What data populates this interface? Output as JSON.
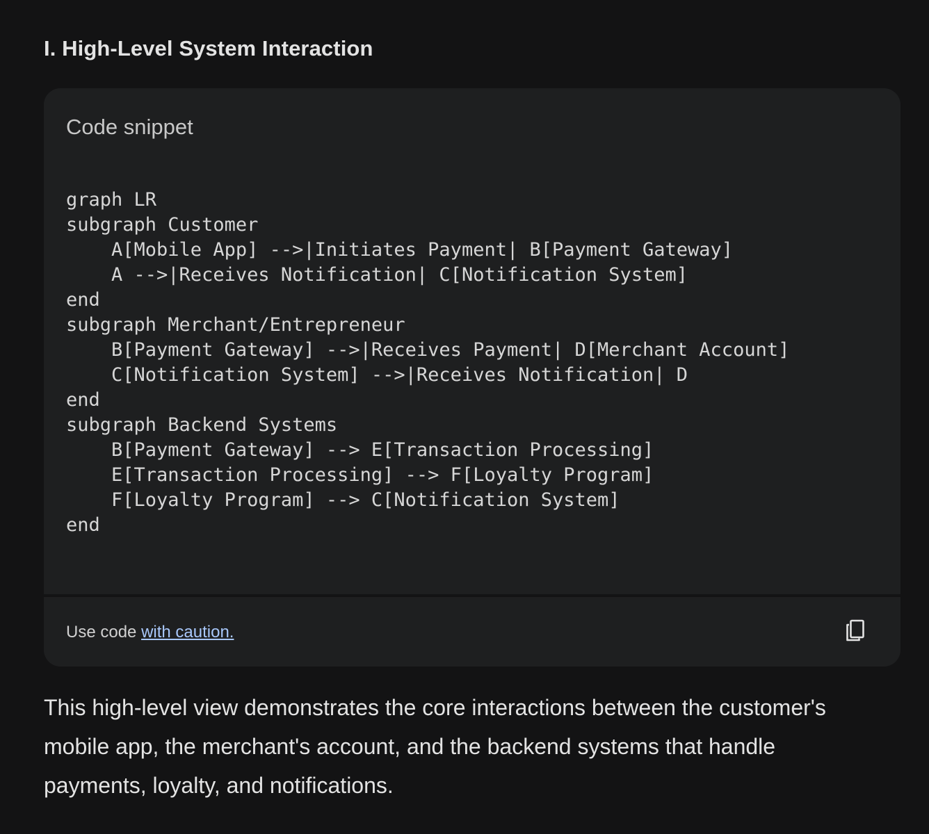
{
  "heading": "I. High-Level System Interaction",
  "code_card": {
    "title": "Code snippet",
    "lines": [
      "graph LR",
      "subgraph Customer",
      "    A[Mobile App] -->|Initiates Payment| B[Payment Gateway]",
      "    A -->|Receives Notification| C[Notification System]",
      "end",
      "subgraph Merchant/Entrepreneur",
      "    B[Payment Gateway] -->|Receives Payment| D[Merchant Account]",
      "    C[Notification System] -->|Receives Notification| D",
      "end",
      "subgraph Backend Systems",
      "    B[Payment Gateway] --> E[Transaction Processing]",
      "    E[Transaction Processing] --> F[Loyalty Program]",
      "    F[Loyalty Program] --> C[Notification System]",
      "end"
    ],
    "footer": {
      "prefix": "Use code ",
      "link_text": "with caution.",
      "copy_icon": "copy-icon"
    }
  },
  "paragraph": "This high-level view demonstrates the core interactions between the customer's mobile app, the merchant's account, and the backend systems that handle payments, loyalty, and notifications.",
  "colors": {
    "background": "#131314",
    "card": "#1e1f20",
    "text": "#e3e3e3",
    "link": "#a8c7fa"
  }
}
